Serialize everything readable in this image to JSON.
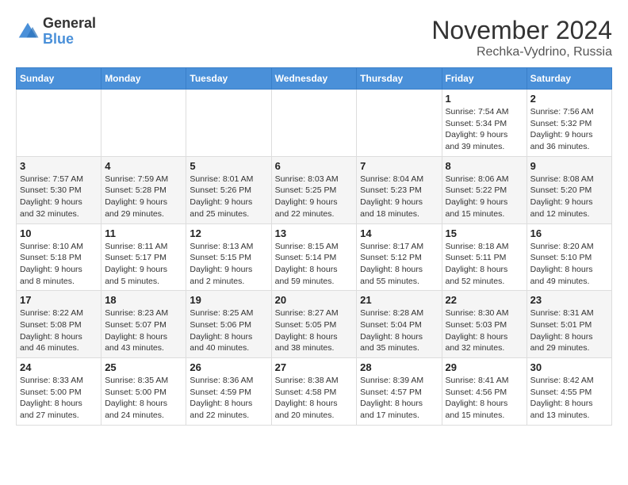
{
  "header": {
    "logo": {
      "general": "General",
      "blue": "Blue"
    },
    "title": "November 2024",
    "location": "Rechka-Vydrino, Russia"
  },
  "weekdays": [
    "Sunday",
    "Monday",
    "Tuesday",
    "Wednesday",
    "Thursday",
    "Friday",
    "Saturday"
  ],
  "weeks": [
    [
      {
        "day": "",
        "info": ""
      },
      {
        "day": "",
        "info": ""
      },
      {
        "day": "",
        "info": ""
      },
      {
        "day": "",
        "info": ""
      },
      {
        "day": "",
        "info": ""
      },
      {
        "day": "1",
        "info": "Sunrise: 7:54 AM\nSunset: 5:34 PM\nDaylight: 9 hours\nand 39 minutes."
      },
      {
        "day": "2",
        "info": "Sunrise: 7:56 AM\nSunset: 5:32 PM\nDaylight: 9 hours\nand 36 minutes."
      }
    ],
    [
      {
        "day": "3",
        "info": "Sunrise: 7:57 AM\nSunset: 5:30 PM\nDaylight: 9 hours\nand 32 minutes."
      },
      {
        "day": "4",
        "info": "Sunrise: 7:59 AM\nSunset: 5:28 PM\nDaylight: 9 hours\nand 29 minutes."
      },
      {
        "day": "5",
        "info": "Sunrise: 8:01 AM\nSunset: 5:26 PM\nDaylight: 9 hours\nand 25 minutes."
      },
      {
        "day": "6",
        "info": "Sunrise: 8:03 AM\nSunset: 5:25 PM\nDaylight: 9 hours\nand 22 minutes."
      },
      {
        "day": "7",
        "info": "Sunrise: 8:04 AM\nSunset: 5:23 PM\nDaylight: 9 hours\nand 18 minutes."
      },
      {
        "day": "8",
        "info": "Sunrise: 8:06 AM\nSunset: 5:22 PM\nDaylight: 9 hours\nand 15 minutes."
      },
      {
        "day": "9",
        "info": "Sunrise: 8:08 AM\nSunset: 5:20 PM\nDaylight: 9 hours\nand 12 minutes."
      }
    ],
    [
      {
        "day": "10",
        "info": "Sunrise: 8:10 AM\nSunset: 5:18 PM\nDaylight: 9 hours\nand 8 minutes."
      },
      {
        "day": "11",
        "info": "Sunrise: 8:11 AM\nSunset: 5:17 PM\nDaylight: 9 hours\nand 5 minutes."
      },
      {
        "day": "12",
        "info": "Sunrise: 8:13 AM\nSunset: 5:15 PM\nDaylight: 9 hours\nand 2 minutes."
      },
      {
        "day": "13",
        "info": "Sunrise: 8:15 AM\nSunset: 5:14 PM\nDaylight: 8 hours\nand 59 minutes."
      },
      {
        "day": "14",
        "info": "Sunrise: 8:17 AM\nSunset: 5:12 PM\nDaylight: 8 hours\nand 55 minutes."
      },
      {
        "day": "15",
        "info": "Sunrise: 8:18 AM\nSunset: 5:11 PM\nDaylight: 8 hours\nand 52 minutes."
      },
      {
        "day": "16",
        "info": "Sunrise: 8:20 AM\nSunset: 5:10 PM\nDaylight: 8 hours\nand 49 minutes."
      }
    ],
    [
      {
        "day": "17",
        "info": "Sunrise: 8:22 AM\nSunset: 5:08 PM\nDaylight: 8 hours\nand 46 minutes."
      },
      {
        "day": "18",
        "info": "Sunrise: 8:23 AM\nSunset: 5:07 PM\nDaylight: 8 hours\nand 43 minutes."
      },
      {
        "day": "19",
        "info": "Sunrise: 8:25 AM\nSunset: 5:06 PM\nDaylight: 8 hours\nand 40 minutes."
      },
      {
        "day": "20",
        "info": "Sunrise: 8:27 AM\nSunset: 5:05 PM\nDaylight: 8 hours\nand 38 minutes."
      },
      {
        "day": "21",
        "info": "Sunrise: 8:28 AM\nSunset: 5:04 PM\nDaylight: 8 hours\nand 35 minutes."
      },
      {
        "day": "22",
        "info": "Sunrise: 8:30 AM\nSunset: 5:03 PM\nDaylight: 8 hours\nand 32 minutes."
      },
      {
        "day": "23",
        "info": "Sunrise: 8:31 AM\nSunset: 5:01 PM\nDaylight: 8 hours\nand 29 minutes."
      }
    ],
    [
      {
        "day": "24",
        "info": "Sunrise: 8:33 AM\nSunset: 5:00 PM\nDaylight: 8 hours\nand 27 minutes."
      },
      {
        "day": "25",
        "info": "Sunrise: 8:35 AM\nSunset: 5:00 PM\nDaylight: 8 hours\nand 24 minutes."
      },
      {
        "day": "26",
        "info": "Sunrise: 8:36 AM\nSunset: 4:59 PM\nDaylight: 8 hours\nand 22 minutes."
      },
      {
        "day": "27",
        "info": "Sunrise: 8:38 AM\nSunset: 4:58 PM\nDaylight: 8 hours\nand 20 minutes."
      },
      {
        "day": "28",
        "info": "Sunrise: 8:39 AM\nSunset: 4:57 PM\nDaylight: 8 hours\nand 17 minutes."
      },
      {
        "day": "29",
        "info": "Sunrise: 8:41 AM\nSunset: 4:56 PM\nDaylight: 8 hours\nand 15 minutes."
      },
      {
        "day": "30",
        "info": "Sunrise: 8:42 AM\nSunset: 4:55 PM\nDaylight: 8 hours\nand 13 minutes."
      }
    ]
  ]
}
